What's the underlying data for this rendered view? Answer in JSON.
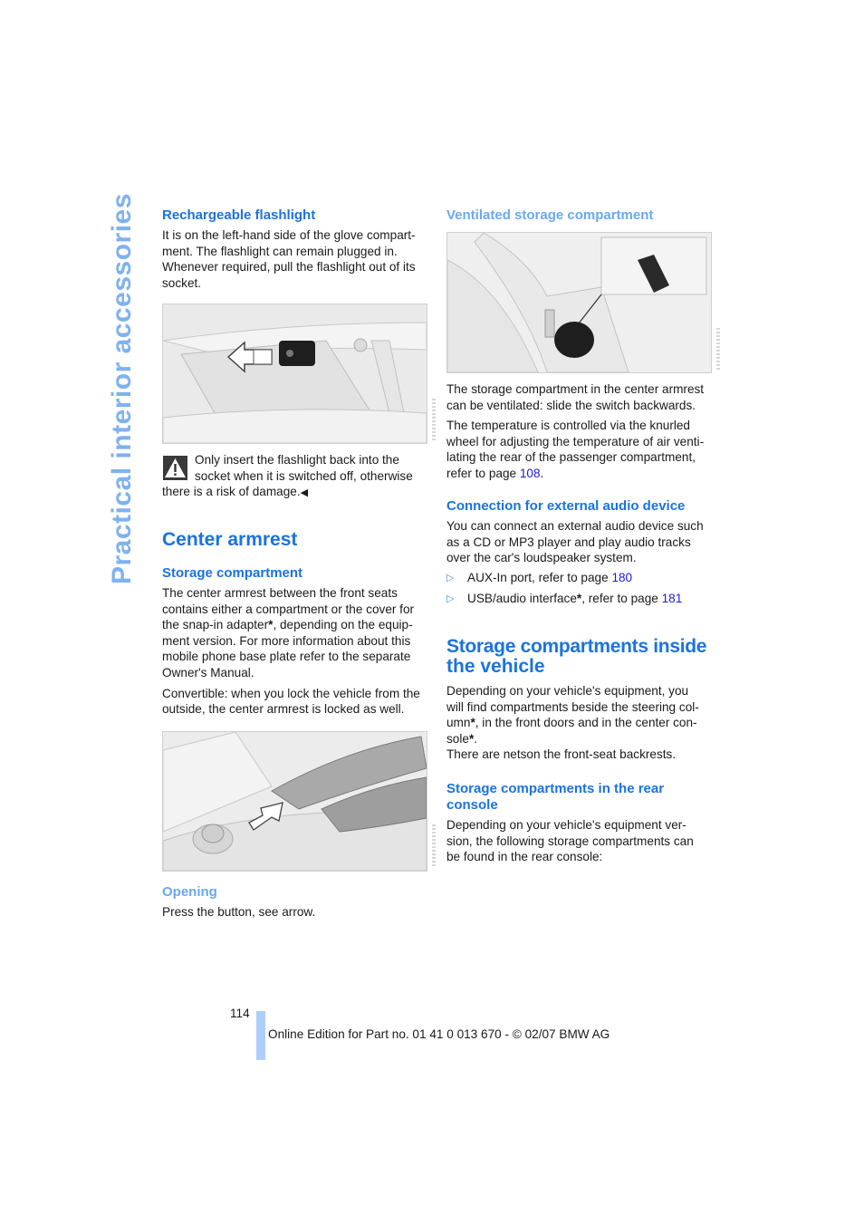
{
  "side_title": "Practical interior accessories",
  "left": {
    "flashlight": {
      "heading": "Rechargeable flashlight",
      "text": "It is on the left-hand side of the glove compartment. The flashlight can remain plugged in. Whenever required, pull the flashlight out of its socket.",
      "lines": [
        "It is on the left-hand side of the glove compart-",
        "ment. The flashlight can remain plugged in.",
        "Whenever required, pull the flashlight out of its",
        "socket."
      ],
      "figure_alt": "Glove compartment flashlight socket with arrow"
    },
    "warning": {
      "icon": "warning-triangle-icon",
      "lines": [
        "Only insert the flashlight back into the",
        "socket when it is switched off, otherwise",
        "there is a risk of damage."
      ],
      "end_mark": "◀"
    },
    "center_armrest": {
      "heading": "Center armrest",
      "storage": {
        "heading": "Storage compartment",
        "para1_lines": [
          "The center armrest between the front seats",
          "contains either a compartment or the cover for",
          "the snap-in adapter",
          ", depending on the equip-",
          "ment version. For more information about this",
          "mobile phone base plate refer to the separate",
          "Owner's Manual."
        ],
        "para2_lines": [
          "Convertible: when you lock the vehicle from the",
          "outside, the center armrest is locked as well."
        ]
      },
      "figure_alt": "Center armrest with button arrow",
      "opening": {
        "heading": "Opening",
        "text": "Press the button, see arrow."
      }
    }
  },
  "right": {
    "ventilated": {
      "heading": "Ventilated storage compartment",
      "figure_alt": "Center console with ventilation switch inset",
      "para1_lines": [
        "The storage compartment in the center armrest",
        "can be ventilated: slide the switch backwards."
      ],
      "para2_lines": [
        "The temperature is controlled via the knurled",
        "wheel for adjusting the temperature of air venti-",
        "lating the rear of the passenger compartment,",
        "refer to page "
      ],
      "para2_link": "108",
      "para2_end": "."
    },
    "audio": {
      "heading": "Connection for external audio device",
      "lines": [
        "You can connect an external audio device such",
        "as a CD or MP3 player and play audio tracks",
        "over the car's loudspeaker system."
      ],
      "bullets": [
        {
          "text": "AUX-In port, refer to page ",
          "link": "180",
          "star": false
        },
        {
          "text": "USB/audio interface",
          "after_star": ", refer to page ",
          "link": "181",
          "star": true
        }
      ],
      "bullet_glyph": "▷"
    },
    "inside": {
      "heading_lines": [
        "Storage compartments inside",
        "the vehicle"
      ],
      "lines": [
        "Depending on your vehicle's equipment, you",
        "will find compartments beside the steering col-",
        "umn",
        ", in the front doors and in the center con-",
        "sole",
        "."
      ],
      "last_line": "There are netson the front-seat backrests."
    },
    "rear_console": {
      "heading_lines": [
        "Storage compartments in the rear",
        "console"
      ],
      "lines": [
        "Depending on your vehicle's equipment ver-",
        "sion, the following storage compartments can",
        "be found in the rear console:"
      ]
    }
  },
  "footer": {
    "page_number": "114",
    "edition": "Online Edition for Part no. 01 41 0 013 670 - © 02/07 BMW AG"
  },
  "star_glyph": "*",
  "colors": {
    "heading": "#1a73e0",
    "subheading_light": "#6aa8f0",
    "side_title": "#7fb2ef",
    "link": "#1a1ad6",
    "footer_bar": "#acd0fb"
  }
}
